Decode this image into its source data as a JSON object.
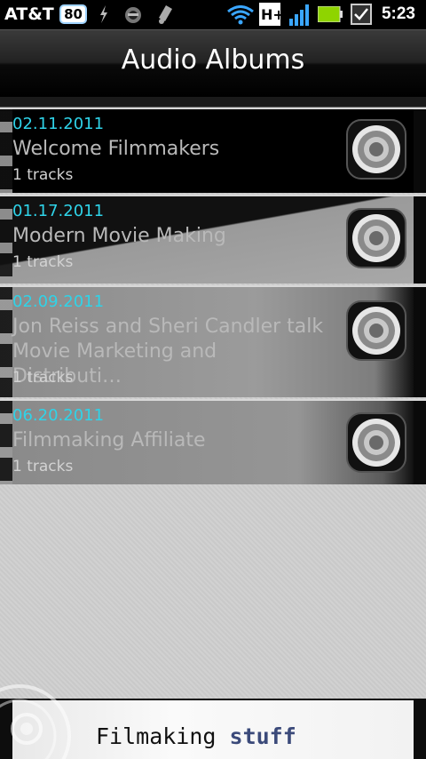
{
  "status_bar": {
    "carrier": "AT&T",
    "battery_badge": "80",
    "network_type": "H+",
    "time": "5:23",
    "icons": [
      "battery-badge-icon",
      "usb-debug-icon",
      "voicemail-icon",
      "notification-icon",
      "wifi-icon",
      "network-type-icon",
      "signal-icon",
      "battery-icon",
      "checkbox-notification-icon"
    ]
  },
  "header": {
    "title": "Audio Albums"
  },
  "albums": [
    {
      "date": "02.11.2011",
      "title": "Welcome Filmmakers",
      "tracks": "1 tracks",
      "icon": "speaker-icon"
    },
    {
      "date": "01.17.2011",
      "title": "Modern Movie Making",
      "tracks": "1 tracks",
      "icon": "speaker-icon"
    },
    {
      "date": "02.09.2011",
      "title": "Jon Reiss and Sheri Candler talk\nMovie Marketing and Distributi…",
      "tracks": "1 tracks",
      "icon": "speaker-icon"
    },
    {
      "date": "06.20.2011",
      "title": "Filmmaking Affiliate",
      "tracks": "1 tracks",
      "icon": "speaker-icon"
    }
  ],
  "footer": {
    "brand_word": "Filmaking",
    "brand_accent": "stuff"
  },
  "colors": {
    "date_accent": "#2fd3e8",
    "title_text": "#b9b9b9",
    "background": "#cfcfcf"
  }
}
